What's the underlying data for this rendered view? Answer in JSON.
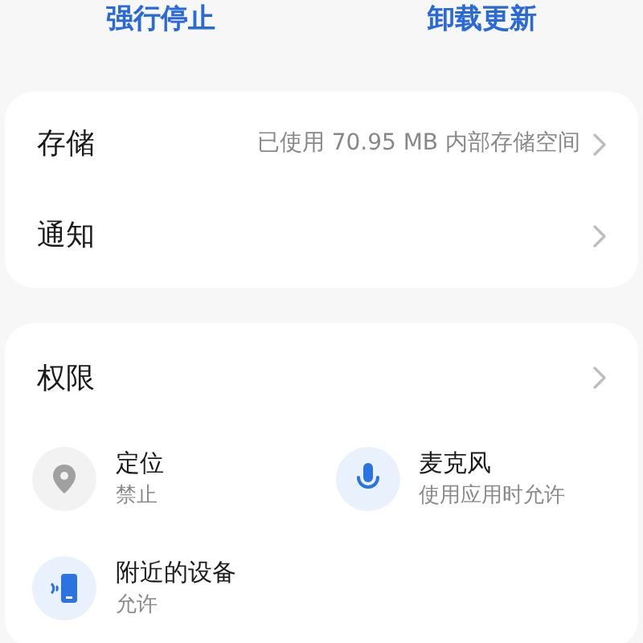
{
  "actions": [
    {
      "label": "强行停止"
    },
    {
      "label": "卸载更新"
    }
  ],
  "settings": [
    {
      "label": "存储",
      "value": "已使用 70.95 MB 内部存储空间"
    },
    {
      "label": "通知"
    }
  ],
  "permissions": {
    "title": "权限",
    "items": [
      {
        "kind": "location",
        "name": "定位",
        "status": "禁止",
        "granted": false
      },
      {
        "kind": "microphone",
        "name": "麦克风",
        "status": "使用应用时允许",
        "granted": true
      },
      {
        "kind": "nearby",
        "name": "附近的设备",
        "status": "允许",
        "granted": true
      }
    ]
  }
}
